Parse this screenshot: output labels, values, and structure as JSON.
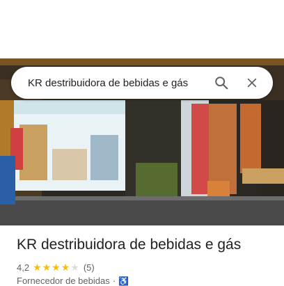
{
  "search": {
    "query": "KR destribuidora de bebidas e gás"
  },
  "place": {
    "title": "KR destribuidora de bebidas e gás",
    "rating": "4,2",
    "rating_value": 4.2,
    "stars_filled": 4,
    "stars_total": 5,
    "stars_text": "★★★★",
    "stars_empty_text": "★",
    "review_count": "(5)",
    "category": "Fornecedor de bebidas",
    "separator": "·"
  },
  "colors": {
    "star": "#fbbc04",
    "text_primary": "#202124",
    "text_secondary": "#5f6368",
    "accessibility": "#1a73e8"
  },
  "icons": {
    "search": "search-icon",
    "close": "close-icon",
    "accessibility": "wheelchair-icon"
  }
}
